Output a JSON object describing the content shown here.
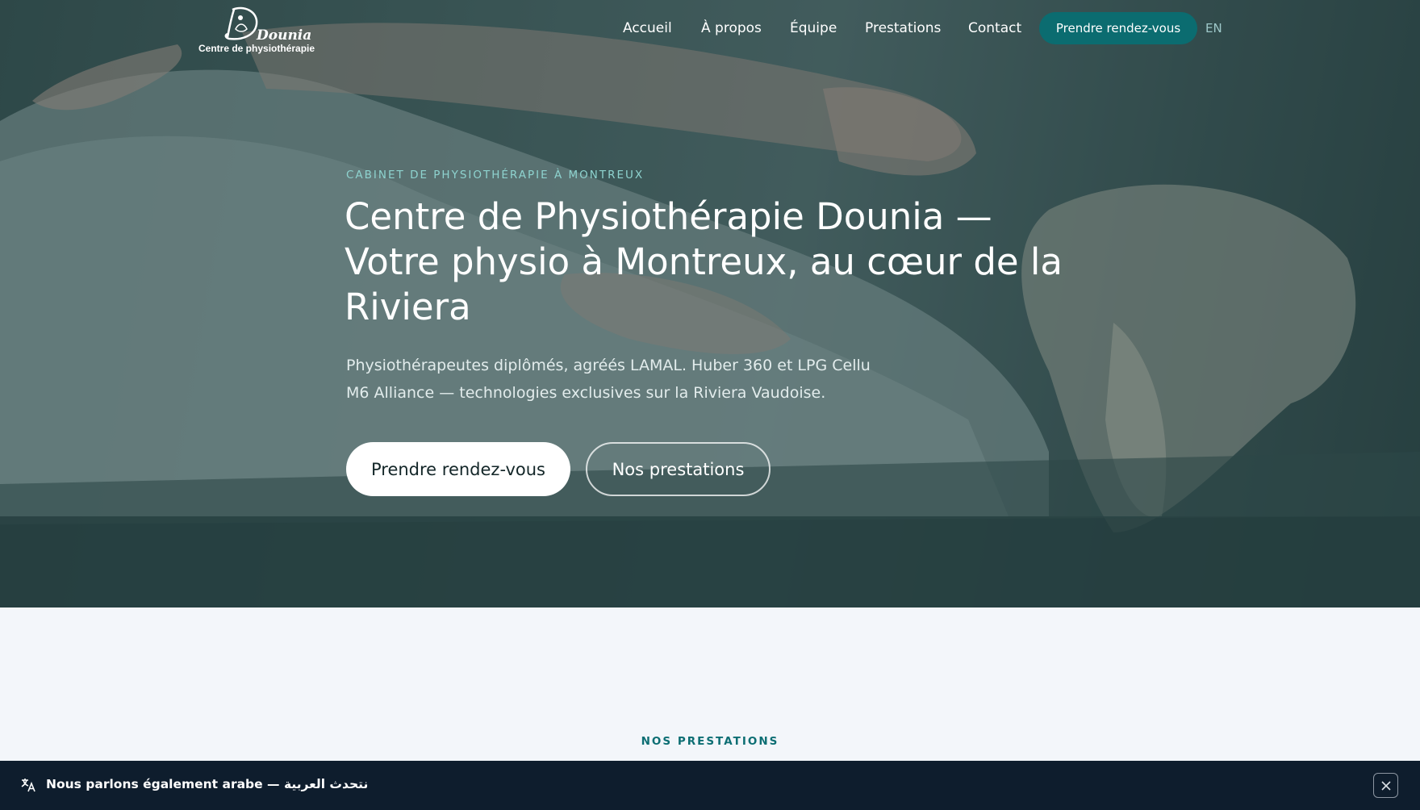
{
  "brand": {
    "name": "Dounia",
    "tagline": "Centre de physiothérapie"
  },
  "nav": {
    "items": [
      {
        "label": "Accueil"
      },
      {
        "label": "À propos"
      },
      {
        "label": "Équipe"
      },
      {
        "label": "Prestations"
      },
      {
        "label": "Contact"
      }
    ],
    "cta_label": "Prendre rendez-vous",
    "lang_label": "EN"
  },
  "hero": {
    "eyebrow": "CABINET DE PHYSIOTHÉRAPIE À MONTREUX",
    "title": "Centre de Physiothérapie Dounia — Votre physio à Montreux, au cœur de la Riviera",
    "subtitle": "Physiothérapeutes diplômés, agréés LAMAL. Huber 360 et LPG Cellu M6 Alliance — technologies exclusives sur la Riviera Vaudoise.",
    "primary_button": "Prendre rendez-vous",
    "secondary_button": "Nos prestations"
  },
  "services": {
    "section_label": "NOS PRESTATIONS"
  },
  "language_banner": {
    "text": "Nous parlons également arabe — نتحدث العربية",
    "icon": "translate-icon",
    "close_icon": "close-icon"
  },
  "colors": {
    "accent": "#0b6c70",
    "eyebrow": "#8ed3cf",
    "banner_bg": "#0e1d2d",
    "page_bg": "#f3f6fa"
  }
}
